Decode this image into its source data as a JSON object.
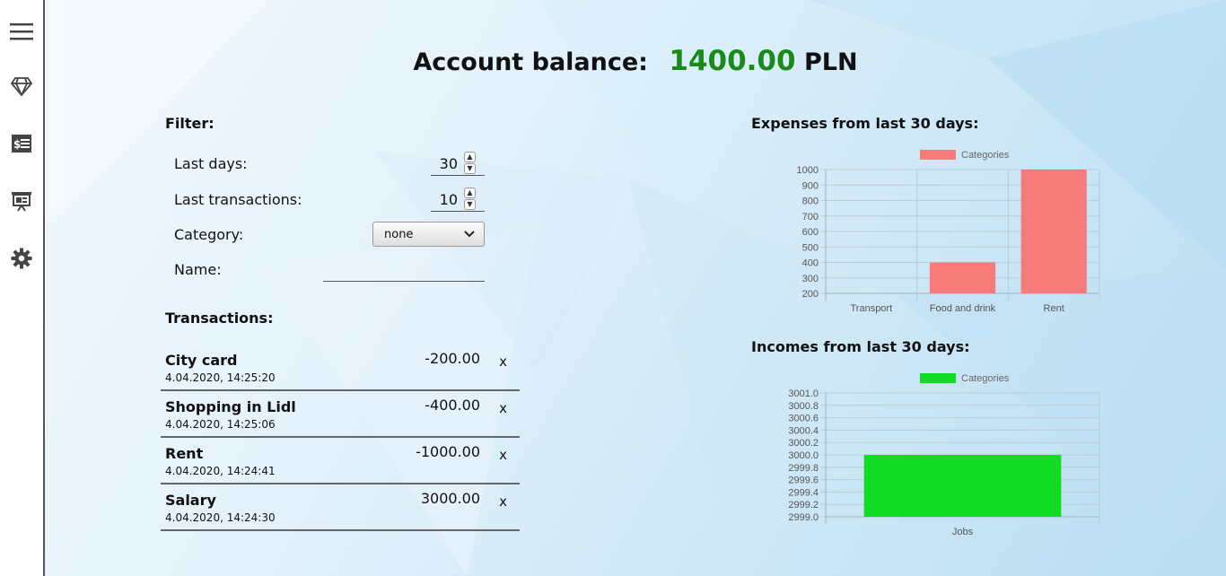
{
  "sidebar": {
    "items": [
      {
        "name": "menu",
        "icon": "hamburger-menu-icon"
      },
      {
        "name": "diamond",
        "icon": "diamond-icon"
      },
      {
        "name": "transactions",
        "icon": "money-receipt-icon"
      },
      {
        "name": "presentation",
        "icon": "presentation-board-icon"
      },
      {
        "name": "settings",
        "icon": "gear-icon"
      }
    ]
  },
  "balance": {
    "label": "Account balance:",
    "amount": "1400.00",
    "currency": "PLN",
    "amount_color": "#1a8a1a"
  },
  "filter": {
    "title": "Filter:",
    "last_days_label": "Last days:",
    "last_days_value": "30",
    "last_tx_label": "Last transactions:",
    "last_tx_value": "10",
    "category_label": "Category:",
    "category_value": "none",
    "name_label": "Name:",
    "name_value": ""
  },
  "transactions": {
    "title": "Transactions:",
    "delete_label": "x",
    "items": [
      {
        "name": "City card",
        "date": "4.04.2020, 14:25:20",
        "amount": "-200.00"
      },
      {
        "name": "Shopping in Lidl",
        "date": "4.04.2020, 14:25:06",
        "amount": "-400.00"
      },
      {
        "name": "Rent",
        "date": "4.04.2020, 14:24:41",
        "amount": "-1000.00"
      },
      {
        "name": "Salary",
        "date": "4.04.2020, 14:24:30",
        "amount": "3000.00"
      }
    ]
  },
  "chart_data": [
    {
      "type": "bar",
      "title": "Expenses from last 30 days:",
      "legend": "Categories",
      "legend_position": "top",
      "color": "#f77b7b",
      "categories": [
        "Transport",
        "Food and drink",
        "Rent"
      ],
      "values": [
        200,
        400,
        1000
      ],
      "ylim": [
        200,
        1000
      ],
      "yticks": [
        "1000",
        "900",
        "800",
        "700",
        "600",
        "500",
        "400",
        "300",
        "200"
      ],
      "grid": true
    },
    {
      "type": "bar",
      "title": "Incomes from last 30 days:",
      "legend": "Categories",
      "legend_position": "top",
      "color": "#10dc26",
      "categories": [
        "Jobs"
      ],
      "values": [
        3000
      ],
      "ylim": [
        2999.0,
        3001.0
      ],
      "yticks": [
        "3001.0",
        "3000.8",
        "3000.6",
        "3000.4",
        "3000.2",
        "3000.0",
        "2999.8",
        "2999.6",
        "2999.4",
        "2999.2",
        "2999.0"
      ],
      "grid": true
    }
  ]
}
